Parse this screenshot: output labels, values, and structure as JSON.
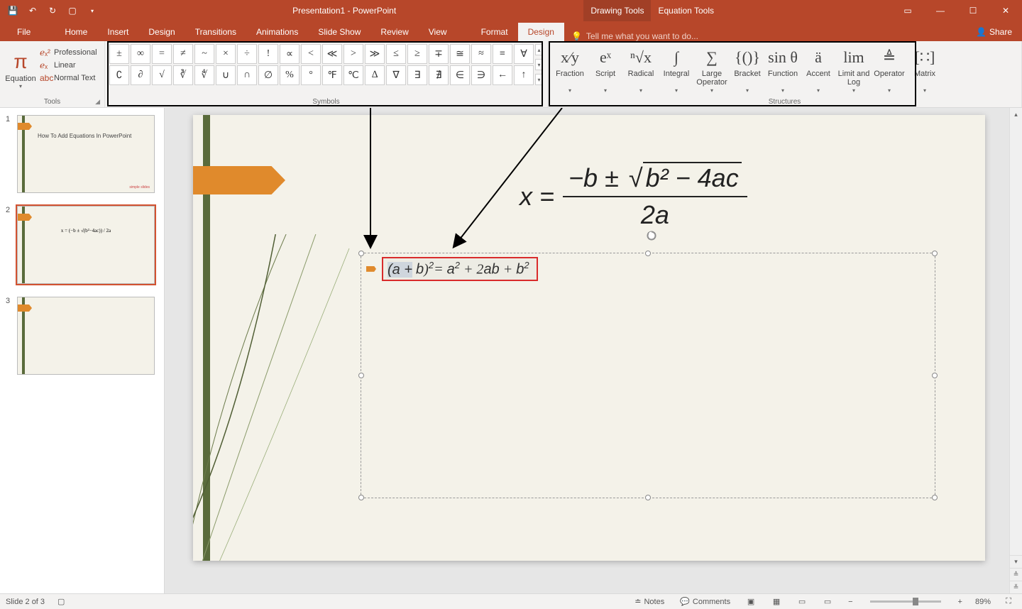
{
  "titlebar": {
    "title": "Presentation1 - PowerPoint",
    "context_tabs": {
      "drawing": "Drawing Tools",
      "equation": "Equation Tools"
    }
  },
  "tabs": {
    "file": "File",
    "home": "Home",
    "insert": "Insert",
    "design_main": "Design",
    "transitions": "Transitions",
    "animations": "Animations",
    "slideshow": "Slide Show",
    "review": "Review",
    "view": "View",
    "format": "Format",
    "design": "Design",
    "tellme_placeholder": "Tell me what you want to do...",
    "share": "Share"
  },
  "ribbon": {
    "tools": {
      "equation": "Equation",
      "conversions": {
        "professional": "Professional",
        "linear": "Linear",
        "normal": "Normal Text"
      },
      "group_label": "Tools"
    },
    "symbols": {
      "group_label": "Symbols",
      "row1": [
        "±",
        "∞",
        "=",
        "≠",
        "~",
        "×",
        "÷",
        "!",
        "∝",
        "<",
        "≪",
        ">",
        "≫",
        "≤",
        "≥",
        "∓",
        "≅",
        "≈",
        "≡",
        "∀"
      ],
      "row2": [
        "∁",
        "∂",
        "√",
        "∛",
        "∜",
        "∪",
        "∩",
        "∅",
        "%",
        "°",
        "℉",
        "℃",
        "∆",
        "∇",
        "∃",
        "∄",
        "∈",
        "∋",
        "←",
        "↑"
      ]
    },
    "structures": {
      "group_label": "Structures",
      "items": [
        {
          "key": "fraction",
          "label": "Fraction",
          "glyph": "x⁄y"
        },
        {
          "key": "script",
          "label": "Script",
          "glyph": "eˣ"
        },
        {
          "key": "radical",
          "label": "Radical",
          "glyph": "ⁿ√x"
        },
        {
          "key": "integral",
          "label": "Integral",
          "glyph": "∫"
        },
        {
          "key": "large-operator",
          "label": "Large Operator",
          "glyph": "∑"
        },
        {
          "key": "bracket",
          "label": "Bracket",
          "glyph": "{()}"
        },
        {
          "key": "function",
          "label": "Function",
          "glyph": "sin θ"
        },
        {
          "key": "accent",
          "label": "Accent",
          "glyph": "ä"
        },
        {
          "key": "limit-log",
          "label": "Limit and Log",
          "glyph": "lim"
        },
        {
          "key": "operator",
          "label": "Operator",
          "glyph": "≜"
        },
        {
          "key": "matrix",
          "label": "Matrix",
          "glyph": "[∷]"
        }
      ]
    }
  },
  "thumbnails": {
    "slide1": {
      "num": "1",
      "title": "How To Add Equations In PowerPoint",
      "logo": "simple slides"
    },
    "slide2": {
      "num": "2",
      "eq": "x = (−b ± √(b²−4ac)) / 2a"
    },
    "slide3": {
      "num": "3"
    }
  },
  "slide": {
    "main_equation": {
      "lhs": "x =",
      "numerator_a": "−b ±",
      "radicand": "b² − 4ac",
      "denominator": "2a"
    },
    "edit_equation": {
      "text_display": "(a + b)² = a² + 2ab + b²"
    }
  },
  "statusbar": {
    "slide_pos": "Slide 2 of 3",
    "notes": "Notes",
    "comments": "Comments",
    "zoom_pct": "89%"
  }
}
